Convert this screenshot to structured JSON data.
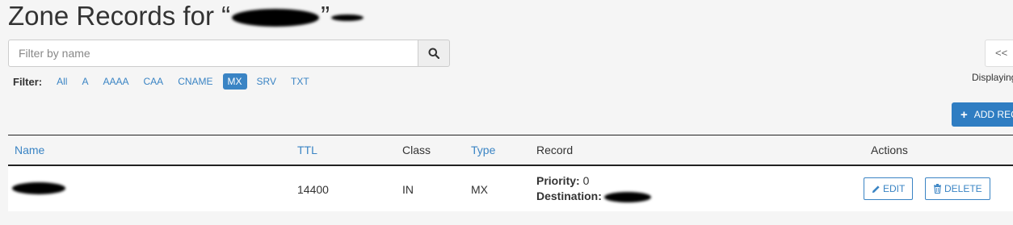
{
  "header": {
    "title_prefix": "Zone Records for “",
    "title_suffix": "”"
  },
  "search": {
    "placeholder": "Filter by name",
    "icon": "search-icon"
  },
  "filter": {
    "label": "Filter:",
    "options": [
      "All",
      "A",
      "AAAA",
      "CAA",
      "CNAME",
      "MX",
      "SRV",
      "TXT"
    ],
    "active": "MX"
  },
  "pagination": {
    "first_label": "<<",
    "status_text": "Displaying"
  },
  "toolbar": {
    "add_label": "ADD REC",
    "add_icon": "plus-icon"
  },
  "table": {
    "headers": {
      "name": "Name",
      "ttl": "TTL",
      "class": "Class",
      "type": "Type",
      "record": "Record",
      "actions": "Actions"
    },
    "rows": [
      {
        "ttl": "14400",
        "class": "IN",
        "type": "MX",
        "priority_label": "Priority:",
        "priority_value": "0",
        "destination_label": "Destination:",
        "edit_label": "EDIT",
        "delete_label": "DELETE"
      }
    ]
  },
  "colors": {
    "accent": "#3a84c4",
    "primary_button": "#2f7dc2",
    "background": "#f5f5f5"
  }
}
